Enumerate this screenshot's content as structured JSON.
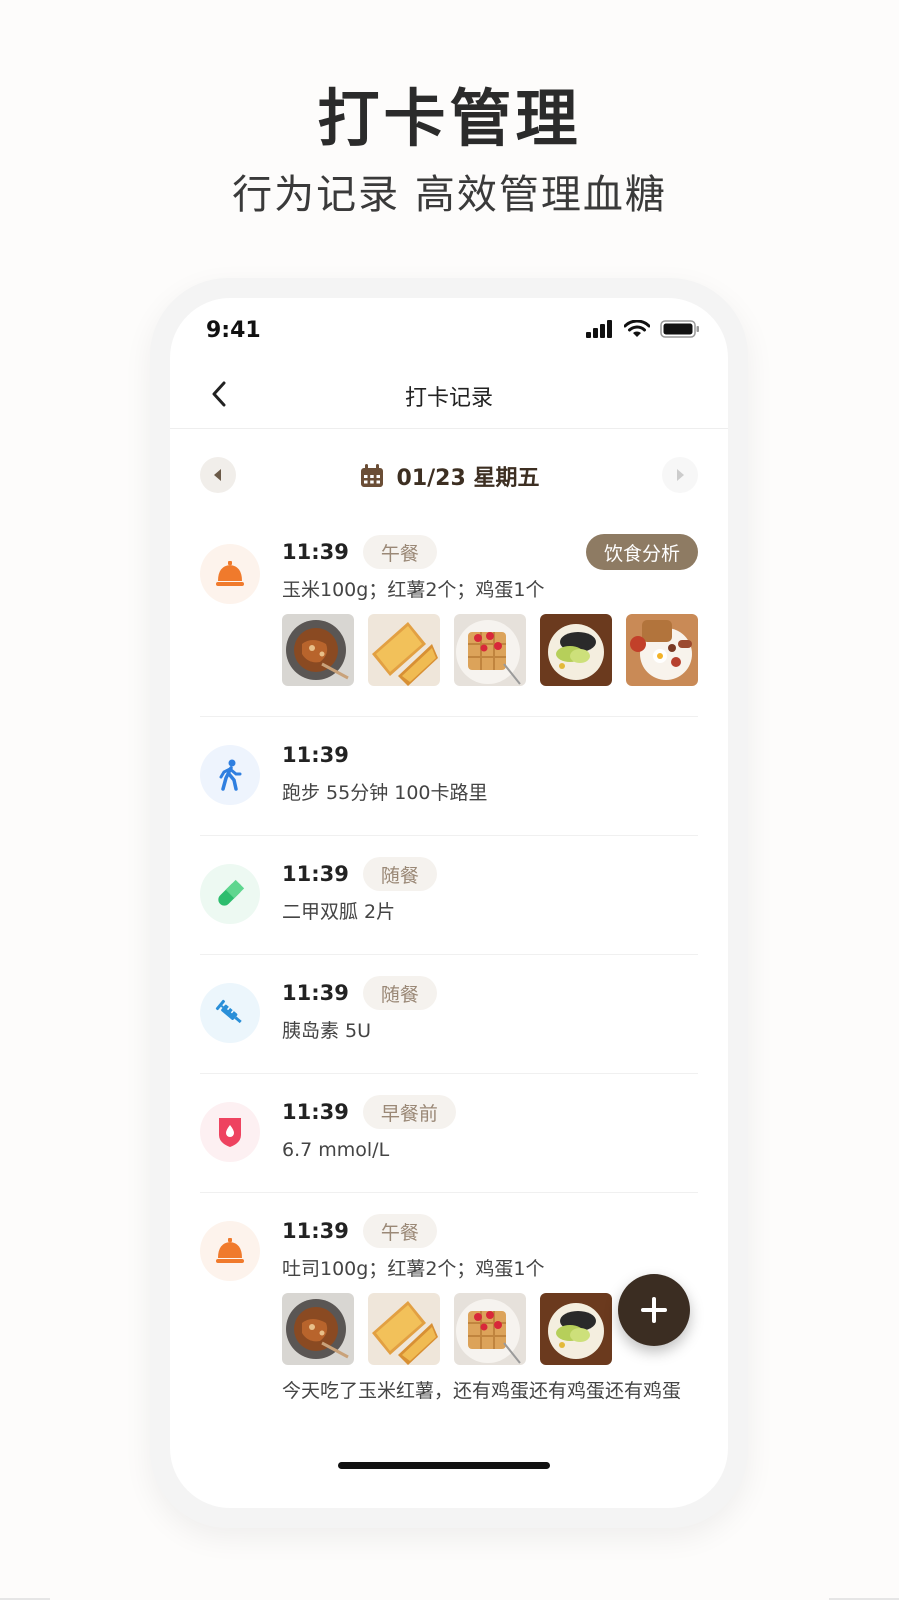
{
  "promo": {
    "title": "打卡管理",
    "subtitle": "行为记录 高效管理血糖"
  },
  "status_bar": {
    "time": "9:41",
    "icons": [
      "signal-icon",
      "wifi-icon",
      "battery-icon"
    ]
  },
  "navbar": {
    "title": "打卡记录",
    "back_icon": "chevron-left-icon"
  },
  "date_bar": {
    "date": "01/23 星期五",
    "icon": "calendar-icon",
    "prev_icon": "caret-left-icon",
    "next_icon": "caret-right-icon"
  },
  "entries": [
    {
      "type": "meal",
      "icon": "food-cloche-icon",
      "time": "11:39",
      "tag": "午餐",
      "action": "饮食分析",
      "desc": "玉米100g；红薯2个；鸡蛋1个",
      "photos": [
        "noodle-plate-photo",
        "toast-sandwich-photo",
        "waffle-photo",
        "avocado-plate-photo",
        "breakfast-platter-photo"
      ]
    },
    {
      "type": "exercise",
      "icon": "walking-person-icon",
      "time": "11:39",
      "desc": "跑步 55分钟 100卡路里"
    },
    {
      "type": "medication",
      "icon": "pill-capsule-icon",
      "time": "11:39",
      "tag": "随餐",
      "desc": "二甲双胍 2片"
    },
    {
      "type": "insulin",
      "icon": "syringe-icon",
      "time": "11:39",
      "tag": "随餐",
      "desc": "胰岛素 5U"
    },
    {
      "type": "glucose",
      "icon": "blood-drop-icon",
      "time": "11:39",
      "tag": "早餐前",
      "desc": "6.7 mmol/L"
    },
    {
      "type": "meal",
      "icon": "food-cloche-icon",
      "time": "11:39",
      "tag": "午餐",
      "desc": "吐司100g；红薯2个；鸡蛋1个",
      "photos": [
        "noodle-plate-photo",
        "toast-sandwich-photo",
        "waffle-photo",
        "avocado-plate-photo"
      ],
      "note": "今天吃了玉米红薯，还有鸡蛋还有鸡蛋还有鸡蛋"
    }
  ],
  "fab": {
    "icon": "plus-icon"
  },
  "colors": {
    "accent": "#8e7b63",
    "fab": "#3b2d22",
    "tag_bg": "#f5f2ee",
    "tag_text": "#9a8876",
    "meal_icon": "#f07a2c",
    "exercise_icon": "#2f7fe0",
    "medication_icon": "#2dbd6e",
    "insulin_icon": "#2a8fd8",
    "glucose_icon": "#ee4360"
  }
}
